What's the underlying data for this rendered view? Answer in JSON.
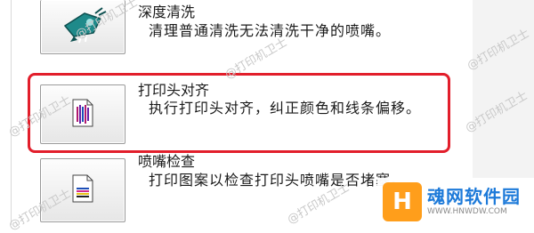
{
  "options": [
    {
      "title": "深度清洗",
      "description": "清理普通清洗无法清洗干净的喷嘴。",
      "icon": "deep-cleaning-icon"
    },
    {
      "title": "打印头对齐",
      "description": "执行打印头对齐，纠正颜色和线条偏移。",
      "icon": "print-head-alignment-icon"
    },
    {
      "title": "喷嘴检查",
      "description": "打印图案以检查打印头喷嘴是否堵塞。",
      "icon": "nozzle-check-icon"
    }
  ],
  "watermark": {
    "text": "@打印机卫士"
  },
  "site_badge": {
    "logo_letter": "H",
    "name": "魂网软件园",
    "url": "WWW.HNWDW.COM"
  },
  "colors": {
    "highlight": "#e21e2b",
    "teal": "#1f8a8a",
    "badge_blue": "#1d7ad9",
    "badge_orange": "#ff9e1b"
  }
}
